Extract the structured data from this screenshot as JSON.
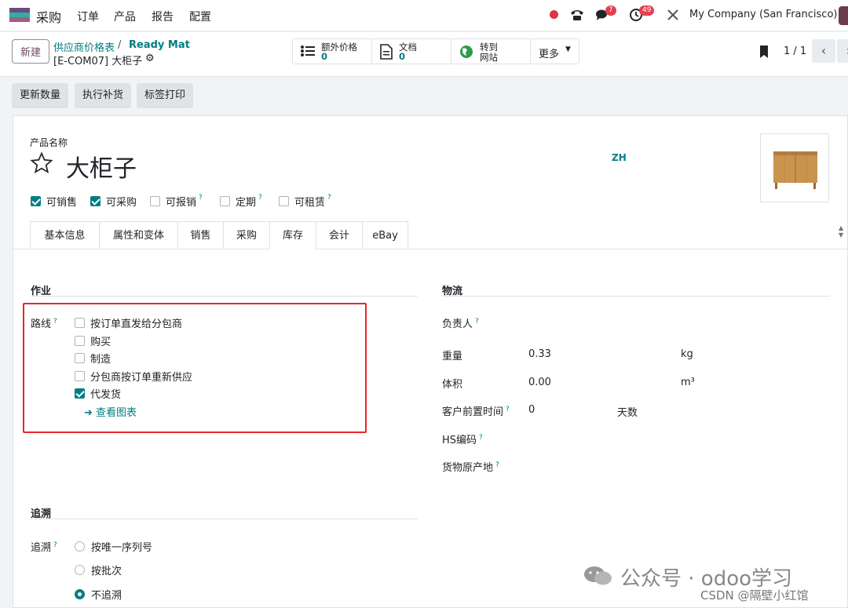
{
  "topbar": {
    "app_name": "采购",
    "menus": [
      "订单",
      "产品",
      "报告",
      "配置"
    ],
    "badge_messages": "7",
    "badge_activities": "49",
    "company": "My Company (San Francisco)"
  },
  "control": {
    "new_label": "新建",
    "breadcrumb_parent": "供应商价格表",
    "breadcrumb_parent2": "Ready Mat",
    "breadcrumb_current": "[E-COM07] 大柜子",
    "stats": [
      {
        "label": "额外价格",
        "value": "0"
      },
      {
        "label": "文档",
        "value": "0"
      },
      {
        "label": "转到",
        "value": "网站"
      },
      {
        "label": "更多"
      }
    ],
    "pager": "1 / 1"
  },
  "actions": [
    "更新数量",
    "执行补货",
    "标签打印"
  ],
  "form": {
    "name_label": "产品名称",
    "name": "大柜子",
    "lang": "ZH",
    "checks": [
      {
        "label": "可销售",
        "checked": true,
        "help": false
      },
      {
        "label": "可采购",
        "checked": true,
        "help": false
      },
      {
        "label": "可报销",
        "checked": false,
        "help": true
      },
      {
        "label": "定期",
        "checked": false,
        "help": true
      },
      {
        "label": "可租赁",
        "checked": false,
        "help": true
      }
    ],
    "tabs": [
      "基本信息",
      "属性和变体",
      "销售",
      "采购",
      "库存",
      "会计",
      "eBay"
    ],
    "active_tab": "库存"
  },
  "operations": {
    "title": "作业",
    "routes_label": "路线",
    "routes": [
      {
        "label": "按订单直发给分包商",
        "checked": false
      },
      {
        "label": "购买",
        "checked": false
      },
      {
        "label": "制造",
        "checked": false
      },
      {
        "label": "分包商按订单重新供应",
        "checked": false
      },
      {
        "label": "代发货",
        "checked": true
      }
    ],
    "view_diagram": "查看图表"
  },
  "logistics": {
    "title": "物流",
    "responsible_label": "负责人",
    "weight_label": "重量",
    "weight_value": "0.33",
    "weight_unit": "kg",
    "volume_label": "体积",
    "volume_value": "0.00",
    "volume_unit": "m³",
    "lead_label": "客户前置时间",
    "lead_value": "0",
    "lead_unit": "天数",
    "hs_label": "HS编码",
    "origin_label": "货物原产地"
  },
  "traceability": {
    "title": "追溯",
    "label": "追溯",
    "options": [
      {
        "label": "按唯一序列号",
        "selected": false
      },
      {
        "label": "按批次",
        "selected": false
      },
      {
        "label": "不追溯",
        "selected": true
      }
    ]
  },
  "watermark": {
    "line1": "公众号 · odoo学习",
    "line2": "CSDN @隔壁小红馆"
  },
  "colors": {
    "accent": "#017e84",
    "brand": "#714b67",
    "highlight_frame": "#e8262b"
  }
}
